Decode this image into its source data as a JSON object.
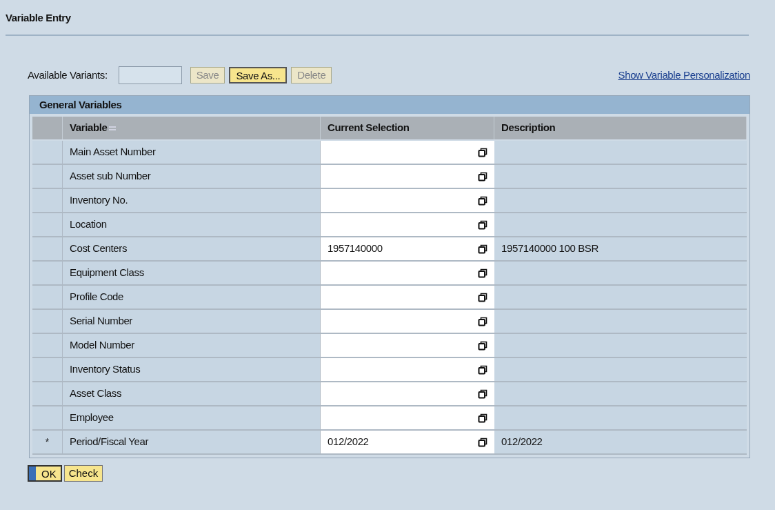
{
  "window": {
    "title": "Variable Entry"
  },
  "variants": {
    "label": "Available Variants:",
    "buttons": [
      {
        "label": "Save",
        "disabled": true
      },
      {
        "label": "Save As...",
        "disabled": false
      },
      {
        "label": "Delete",
        "disabled": true
      }
    ],
    "personalization_link": "Show Variable Personalization"
  },
  "table": {
    "title": "General Variables",
    "columns": [
      "Variable",
      "Current Selection",
      "Description"
    ],
    "rows": [
      {
        "variable": "Main Asset Number"
      },
      {
        "variable": "Asset sub Number"
      },
      {
        "variable": "Inventory No."
      },
      {
        "variable": "Location"
      },
      {
        "variable": "Cost Centers",
        "selection": "1957140000",
        "description": "1957140000 100 BSR"
      },
      {
        "variable": "Equipment Class"
      },
      {
        "variable": "Profile Code"
      },
      {
        "variable": "Serial Number"
      },
      {
        "variable": "Model Number"
      },
      {
        "variable": "Inventory Status"
      },
      {
        "variable": "Asset Class"
      },
      {
        "variable": "Employee"
      },
      {
        "marker": "*",
        "variable": "Period/Fiscal Year",
        "selection": "012/2022",
        "description": "012/2022"
      }
    ]
  },
  "actions": [
    {
      "label": "OK",
      "kind": "primary"
    },
    {
      "label": "Check",
      "kind": "secondary"
    }
  ]
}
